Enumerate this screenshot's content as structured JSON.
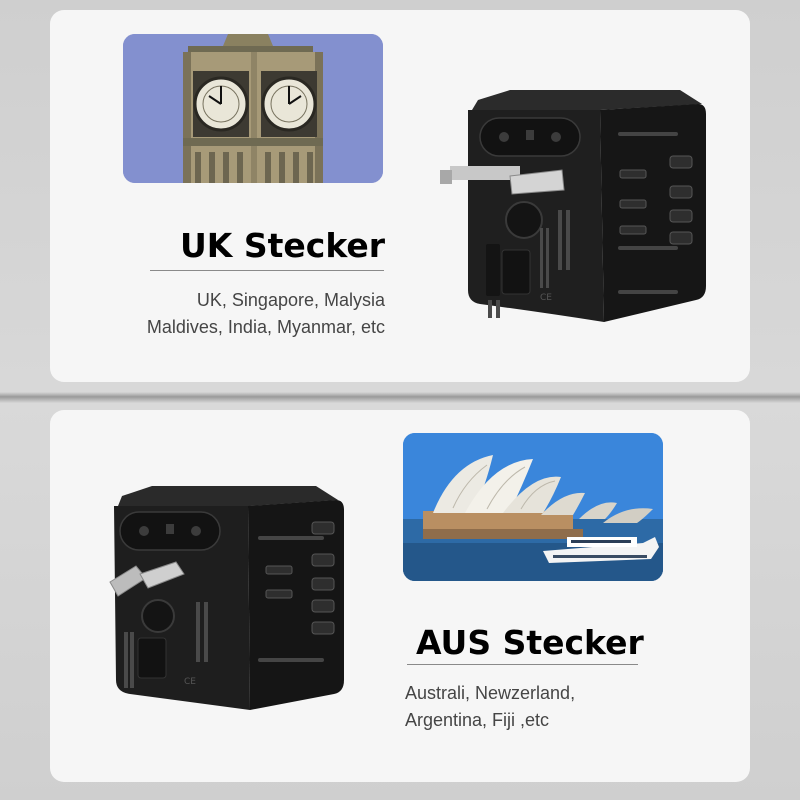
{
  "uk": {
    "heading": "UK Stecker",
    "countries_line1": "UK, Singapore, Malysia",
    "countries_line2": "Maldives, India, Myanmar, etc"
  },
  "aus": {
    "heading": "AUS Stecker",
    "countries_line1": "Australi, Newzerland,",
    "countries_line2": "Argentina, Fiji ,etc"
  },
  "colors": {
    "card_background": "#f6f6f6",
    "page_background": "#cfcfcf",
    "heading_text": "#000000",
    "body_text": "#454545",
    "adapter_body": "#1c1c1c"
  },
  "icons": [
    "big-ben-photo",
    "sydney-opera-house-photo",
    "travel-adapter-uk-icon",
    "travel-adapter-aus-icon"
  ]
}
